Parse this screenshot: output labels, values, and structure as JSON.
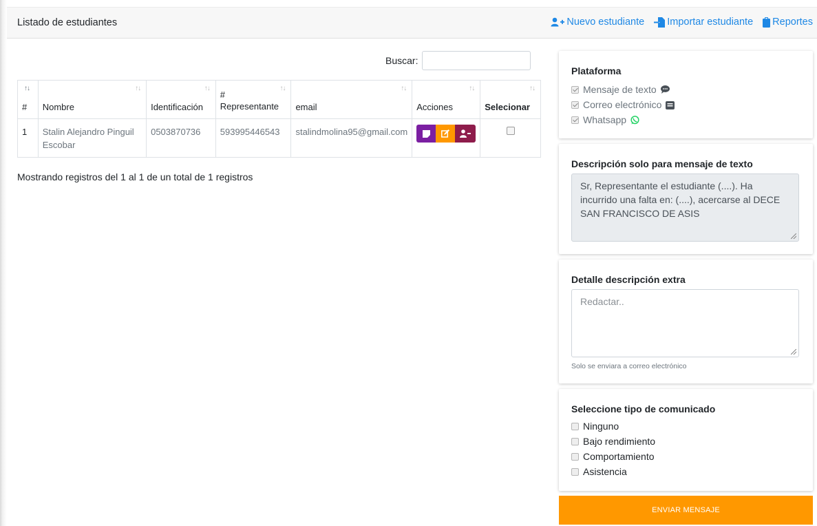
{
  "header": {
    "title": "Listado de estudiantes",
    "actions": [
      {
        "label": "Nuevo estudiante",
        "icon": "user-plus-icon"
      },
      {
        "label": "Importar estudiante",
        "icon": "file-import-icon"
      },
      {
        "label": "Reportes",
        "icon": "clipboard-icon"
      }
    ]
  },
  "search": {
    "label": "Buscar:",
    "value": "",
    "placeholder": ""
  },
  "table": {
    "columns": [
      "#",
      "Nombre",
      "Identificación",
      "# Representante",
      "email",
      "Acciones",
      "Selecionar"
    ],
    "rows": [
      {
        "num": "1",
        "nombre": "Stalin Alejandro Pinguil Escobar",
        "identificacion": "0503870736",
        "representante": "593995446543",
        "email": "stalindmolina95@gmail.com"
      }
    ]
  },
  "footer_info": "Mostrando registros del 1 al 1 de un total de 1 registros",
  "platform": {
    "title": "Plataforma",
    "options": [
      {
        "label": "Mensaje de texto",
        "checked": true,
        "icon": "comment-icon"
      },
      {
        "label": "Correo electrónico",
        "checked": true,
        "icon": "envelope-open-icon"
      },
      {
        "label": "Whatsapp",
        "checked": true,
        "icon": "whatsapp-icon"
      }
    ]
  },
  "description": {
    "title": "Descripción solo para mensaje de texto",
    "text": "Sr, Representante el estudiante (....). Ha incurrido una falta en: (....), acercarse al DECE SAN FRANCISCO DE ASIS"
  },
  "extra": {
    "title": "Detalle descripción extra",
    "placeholder": "Redactar..",
    "note": "Solo se enviara a correo electrónico"
  },
  "comunicado": {
    "title": "Seleccione tipo de comunicado",
    "options": [
      "Ninguno",
      "Bajo rendimiento",
      "Comportamiento",
      "Asistencia"
    ]
  },
  "send_button": "ENVIAR MENSAJE",
  "colors": {
    "link": "#1e88e5",
    "purple": "#7b1fa2",
    "orange": "#ff9800",
    "maroon": "#8e1c4b",
    "whatsapp": "#25d366"
  }
}
